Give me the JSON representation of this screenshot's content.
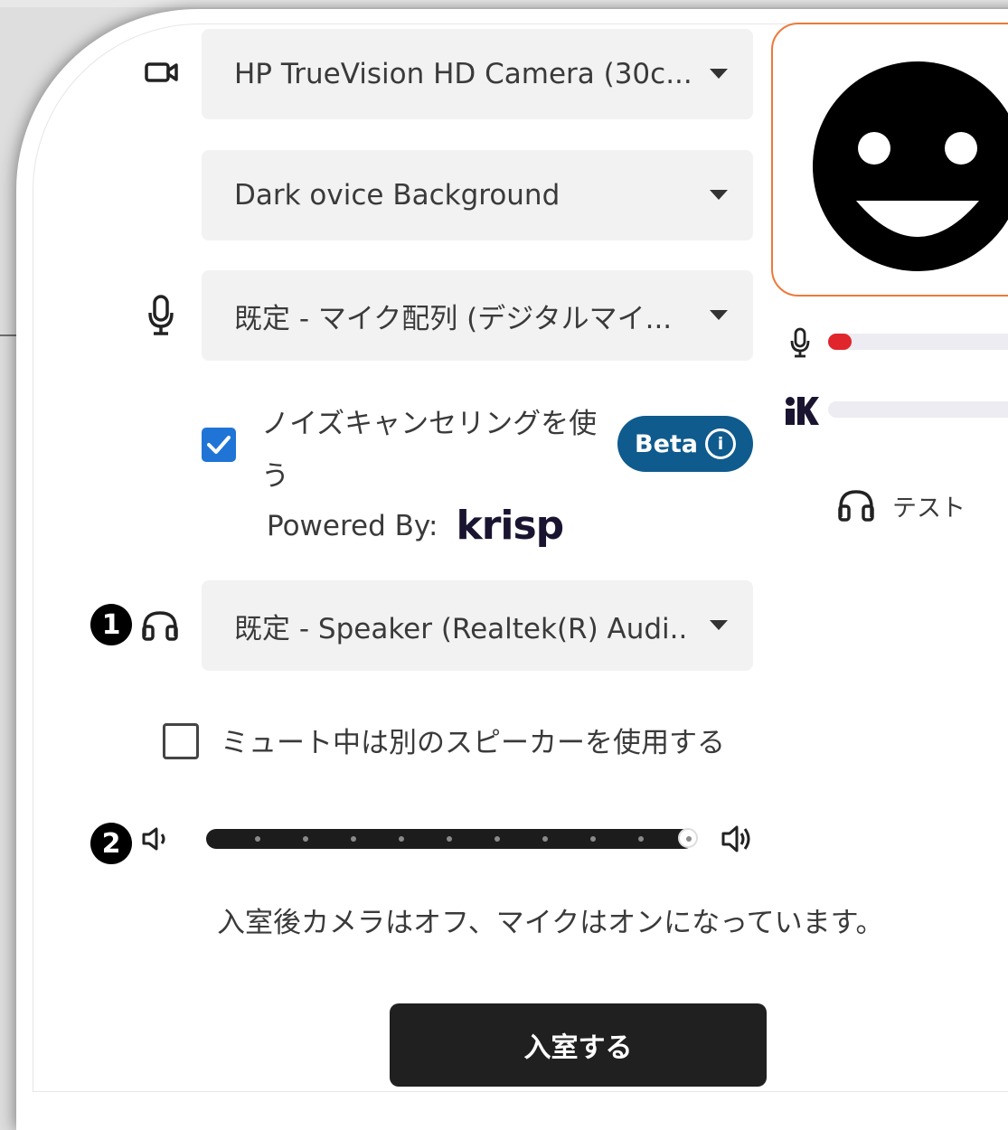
{
  "devices": {
    "camera": {
      "value": "HP TrueVision HD Camera (30c..."
    },
    "background": {
      "value": "Dark ovice Background"
    },
    "microphone": {
      "value": "既定 - マイク配列 (デジタルマイ..."
    },
    "speaker": {
      "value": "既定 - Speaker (Realtek(R) Audi..."
    }
  },
  "noise_cancel": {
    "checked": true,
    "label": "ノイズキャンセリングを使う",
    "beta_label": "Beta",
    "info_icon": "i",
    "powered_by": "Powered By:",
    "brand": "krisp"
  },
  "mute_speaker": {
    "checked": false,
    "label": "ミュート中は別のスピーカーを使用する"
  },
  "volume": {
    "level": 1.0
  },
  "badges": {
    "speaker": "1",
    "volume": "2"
  },
  "notice": "入室後カメラはオフ、マイクはオンになっています。",
  "enter_button": "入室する",
  "test_button": "テスト",
  "meters": {
    "mic_level": 0.03,
    "krisp_level": 0.0
  },
  "colors": {
    "accent_blue": "#1f74d6",
    "beta_bg": "#0f5b8e",
    "preview_border": "#ec7a3b",
    "mic_meter": "#e0262c",
    "button_bg": "#202020"
  }
}
